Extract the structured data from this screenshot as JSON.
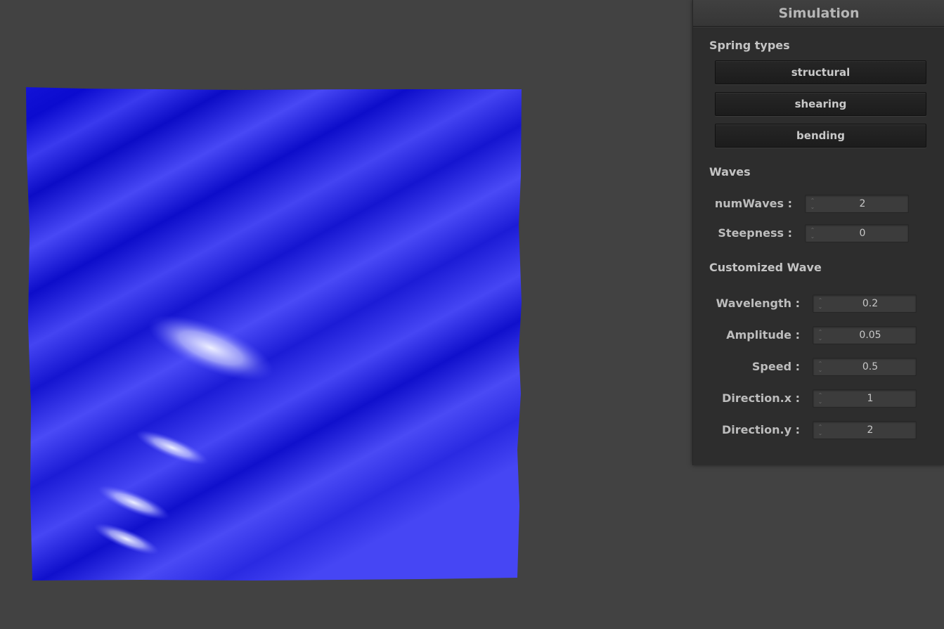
{
  "panel": {
    "title": "Simulation",
    "spring_section": "Spring types",
    "spring_buttons": [
      "structural",
      "shearing",
      "bending"
    ],
    "waves_section": "Waves",
    "waves_fields": [
      {
        "label": "numWaves :",
        "value": "2"
      },
      {
        "label": "Steepness :",
        "value": "0"
      }
    ],
    "custom_section": "Customized Wave",
    "custom_fields": [
      {
        "label": "Wavelength :",
        "value": "0.2"
      },
      {
        "label": "Amplitude :",
        "value": "0.05"
      },
      {
        "label": "Speed :",
        "value": "0.5"
      },
      {
        "label": "Direction.x :",
        "value": "1"
      },
      {
        "label": "Direction.y :",
        "value": "2"
      }
    ]
  },
  "colors": {
    "background": "#424242",
    "cloth": "#3d3df0",
    "cloth_dark": "#0a0ac8",
    "highlight": "#e8eaff"
  }
}
